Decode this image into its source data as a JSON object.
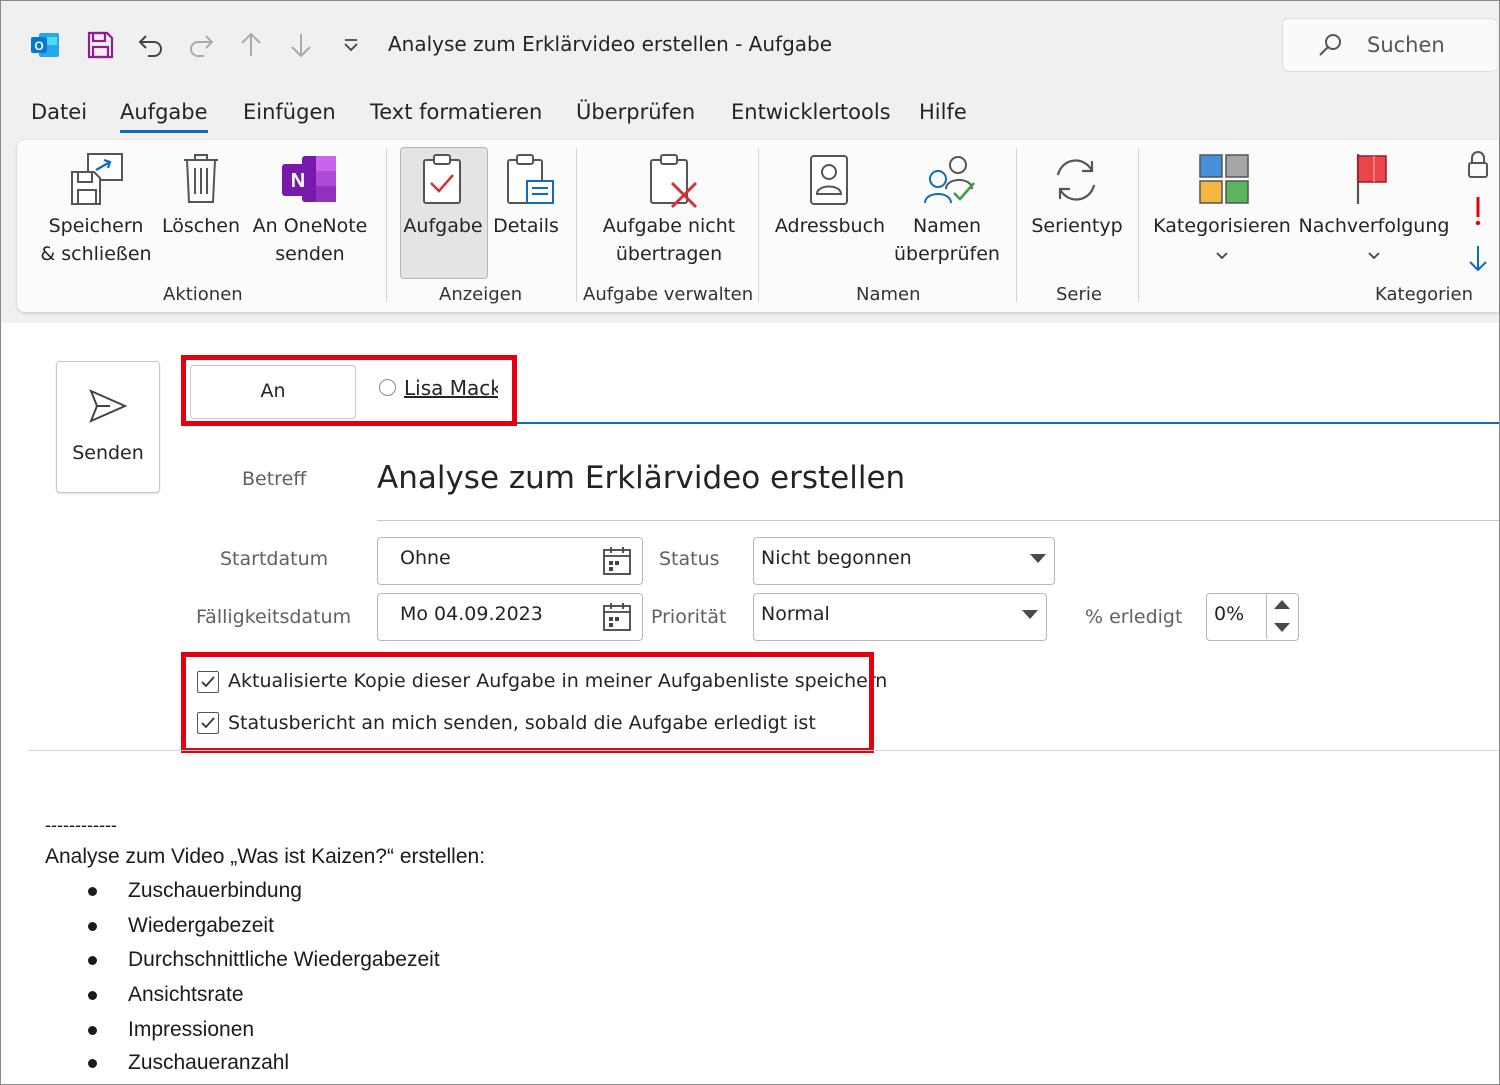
{
  "window": {
    "title": "Analyse zum Erklärvideo erstellen  -  Aufgabe",
    "search_placeholder": "Suchen"
  },
  "menu": [
    "Datei",
    "Aufgabe",
    "Einfügen",
    "Text formatieren",
    "Überprüfen",
    "Entwicklertools",
    "Hilfe"
  ],
  "ribbon": {
    "save_close": [
      "Speichern",
      "& schließen"
    ],
    "delete": "Löschen",
    "onenote": [
      "An OneNote",
      "senden"
    ],
    "task": "Aufgabe",
    "details": "Details",
    "decline_task": [
      "Aufgabe nicht",
      "übertragen"
    ],
    "addressbook": "Adressbuch",
    "check_names": [
      "Namen",
      "überprüfen"
    ],
    "recurrence": "Serientyp",
    "categorize": "Kategorisieren",
    "followup": "Nachverfolgung",
    "groups": {
      "actions": "Aktionen",
      "show": "Anzeigen",
      "manage": "Aufgabe verwalten",
      "names": "Namen",
      "series": "Serie",
      "tags": "Kategorien"
    }
  },
  "form": {
    "send": "Senden",
    "to": "An",
    "recipient": "Lisa Mack;",
    "subject_label": "Betreff",
    "subject": "Analyse zum Erklärvideo erstellen",
    "start_label": "Startdatum",
    "start_value": "Ohne",
    "due_label": "Fälligkeitsdatum",
    "due_value": "Mo 04.09.2023",
    "status_label": "Status",
    "status_value": "Nicht begonnen",
    "priority_label": "Priorität",
    "priority_value": "Normal",
    "percent_label": "% erledigt",
    "percent_value": "0%",
    "check1": "Aktualisierte Kopie dieser Aufgabe in meiner Aufgabenliste speichern",
    "check2": "Statusbericht an mich senden, sobald die Aufgabe erledigt ist"
  },
  "body": {
    "separator": "------------",
    "intro": "Analyse zum Video „Was ist Kaizen?“ erstellen:",
    "items": [
      "Zuschauerbindung",
      "Wiedergabezeit",
      "Durchschnittliche Wiedergabezeit",
      "Ansichtsrate",
      "Impressionen",
      "Zuschaueranzahl"
    ]
  },
  "colors": {
    "accent": "#0f6cbd",
    "highlight_box": "#e3000f",
    "outlook_blue": "#0078d4",
    "onenote_purple": "#7719aa",
    "save_purple": "#8e1e8c"
  }
}
